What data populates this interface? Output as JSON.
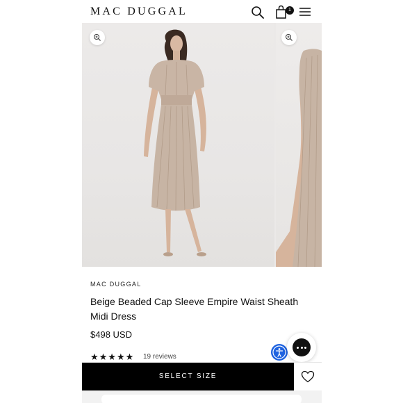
{
  "header": {
    "logo": "MAC DUGGAL",
    "cart_count": "1",
    "icons": [
      "search-icon",
      "shopping-bag-icon",
      "hamburger-menu-icon"
    ]
  },
  "gallery": {
    "icons": [
      "zoom-in-icon",
      "zoom-in-icon"
    ]
  },
  "product": {
    "brand": "MAC DUGGAL",
    "title": "Beige Beaded Cap Sleeve Empire Waist Sheath Midi Dress",
    "price": "$498 USD",
    "rating": 5,
    "stars": "★★★★★",
    "reviews": "19 reviews"
  },
  "actions": {
    "select_size": "SELECT SIZE",
    "wishlist_icon": "heart-icon",
    "accessibility_icon": "accessibility-icon",
    "chat_icon": "chat-icon"
  },
  "colors": {
    "primary": "#000000",
    "background": "#ffffff",
    "accessibility": "#1f63e0",
    "dress": "#c7b4a4"
  }
}
